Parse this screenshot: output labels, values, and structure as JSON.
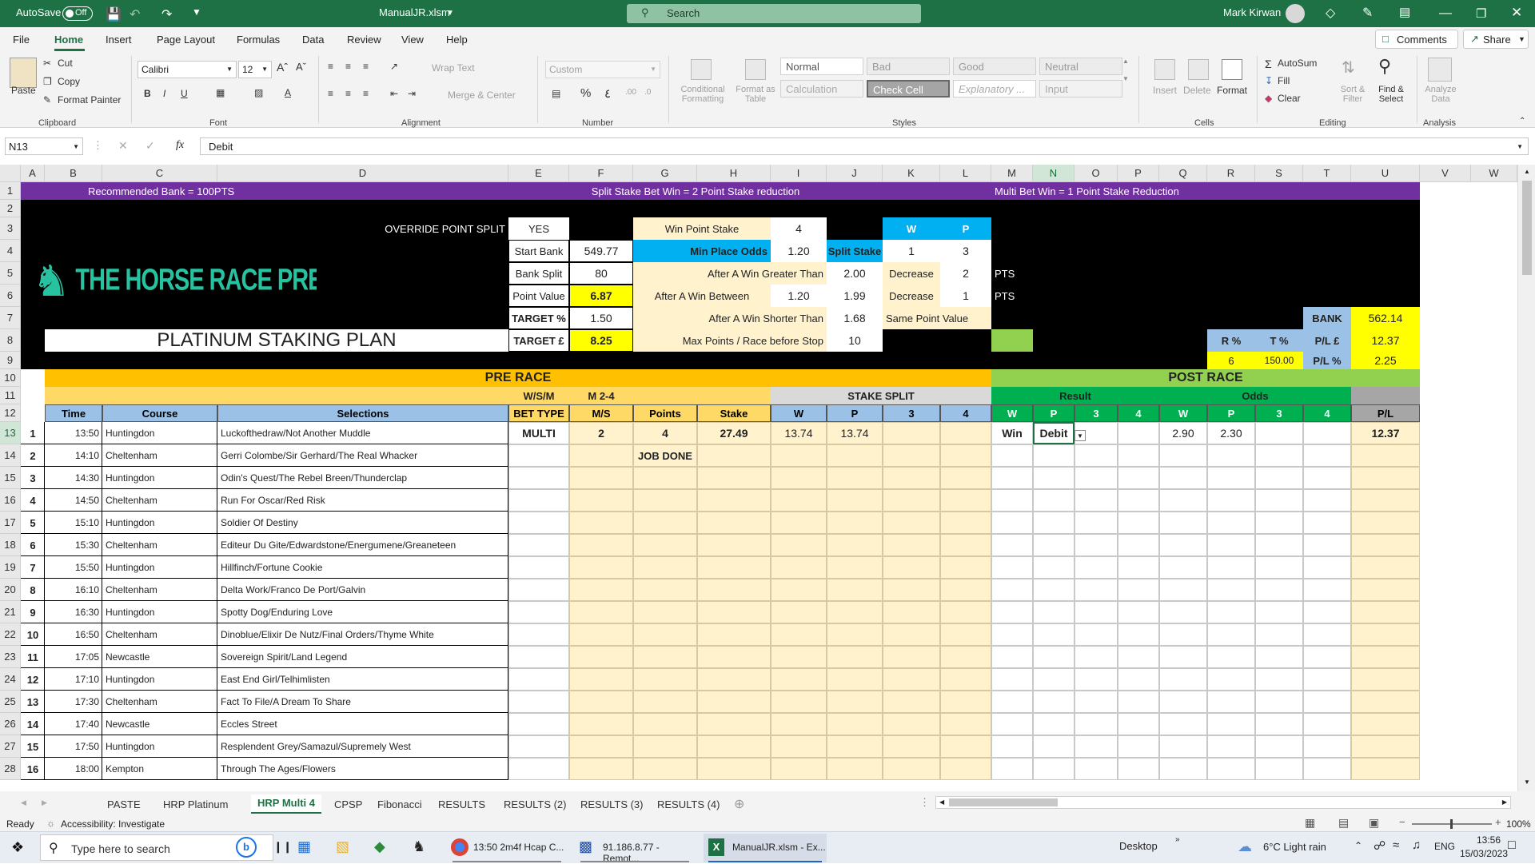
{
  "title_bar": {
    "autosave_label": "AutoSave",
    "autosave_state": "Off",
    "file_name": "ManualJR.xlsm",
    "search_placeholder": "Search",
    "user_name": "Mark Kirwan"
  },
  "menu": {
    "tabs": [
      "File",
      "Home",
      "Insert",
      "Page Layout",
      "Formulas",
      "Data",
      "Review",
      "View",
      "Help"
    ],
    "active_tab": "Home",
    "comments": "Comments",
    "share": "Share"
  },
  "ribbon": {
    "clipboard": {
      "paste": "Paste",
      "cut": "Cut",
      "copy": "Copy",
      "format_painter": "Format Painter",
      "group": "Clipboard"
    },
    "font": {
      "name": "Calibri",
      "size": "12",
      "group": "Font"
    },
    "alignment": {
      "wrap_text": "Wrap Text",
      "merge_center": "Merge & Center",
      "group": "Alignment"
    },
    "number": {
      "format": "Custom",
      "group": "Number"
    },
    "styles": {
      "conditional_formatting": "Conditional Formatting",
      "format_as_table": "Format as Table",
      "normal": "Normal",
      "bad": "Bad",
      "good": "Good",
      "neutral": "Neutral",
      "calculation": "Calculation",
      "check_cell": "Check Cell",
      "explanatory": "Explanatory ...",
      "input": "Input",
      "group": "Styles"
    },
    "cells": {
      "insert": "Insert",
      "delete": "Delete",
      "format": "Format",
      "group": "Cells"
    },
    "editing": {
      "autosum": "AutoSum",
      "fill": "Fill",
      "clear": "Clear",
      "sort_filter": "Sort & Filter",
      "find_select": "Find & Select",
      "group": "Editing"
    },
    "analysis": {
      "analyze_data": "Analyze Data",
      "group": "Analysis"
    }
  },
  "formula_bar": {
    "name_box": "N13",
    "fx": "fx",
    "value": "Debit"
  },
  "columns": [
    "A",
    "B",
    "C",
    "D",
    "E",
    "F",
    "G",
    "H",
    "I",
    "J",
    "K",
    "L",
    "M",
    "N",
    "O",
    "P",
    "Q",
    "R",
    "S",
    "T",
    "U",
    "V",
    "W"
  ],
  "row_numbers": [
    "1",
    "2",
    "3",
    "4",
    "5",
    "6",
    "7",
    "8",
    "9",
    "10",
    "11",
    "12",
    "13",
    "14",
    "15",
    "16",
    "17",
    "18",
    "19",
    "20",
    "21",
    "22",
    "23",
    "24",
    "25",
    "26",
    "27",
    "28"
  ],
  "sheet": {
    "banner_left": "Recommended Bank = 100PTS",
    "banner_mid": "Split Stake Bet Win = 2 Point Stake reduction",
    "banner_right": "Multi Bet Win = 1 Point  Stake Reduction",
    "logo_text": "THE HORSE RACE PREDICTOR",
    "plan_title": "PLATINUM STAKING PLAN",
    "override_label": "OVERRIDE POINT SPLIT",
    "override_value": "YES",
    "start_bank_label": "Start Bank",
    "start_bank": "549.77",
    "bank_split_label": "Bank Split",
    "bank_split": "80",
    "point_value_label": "Point Value",
    "point_value": "6.87",
    "target_pct_label": "TARGET %",
    "target_pct": "1.50",
    "target_gbp_label": "TARGET £",
    "target_gbp": "8.25",
    "win_point_stake_label": "Win Point Stake",
    "win_point_stake": "4",
    "min_place_odds_label": "Min Place Odds",
    "min_place_odds": "1.20",
    "split_stake_label": "Split Stake",
    "split_w": "1",
    "split_p": "3",
    "w_label": "W",
    "p_label": "P",
    "after_win_greater_label": "After A Win Greater Than",
    "after_win_greater": "2.00",
    "decrease_label": "Decrease",
    "decrease_1": "2",
    "pts1": "PTS",
    "after_win_between_label": "After A Win Between",
    "between_low": "1.20",
    "between_high": "1.99",
    "decrease_2": "1",
    "pts2": "PTS",
    "after_win_shorter_label": "After A Win Shorter Than",
    "shorter": "1.68",
    "same_point_value": "Same Point Value",
    "max_points_label": "Max Points / Race before Stop",
    "max_points": "10",
    "bank_label": "BANK",
    "bank": "562.14",
    "r_pct_label": "R %",
    "t_pct_label": "T %",
    "pl_gbp_label": "P/L £",
    "pl_gbp": "12.37",
    "r_pct": "6",
    "t_pct": "150.00",
    "pl_pct_label": "P/L %",
    "pl_pct": "2.25",
    "pre_race": "PRE RACE",
    "post_race": "POST RACE",
    "wsm": "W/S/M",
    "m24": "M 2-4",
    "stake_split": "STAKE SPLIT",
    "result": "Result",
    "odds": "Odds",
    "headers": [
      "Time",
      "Course",
      "Selections",
      "BET TYPE",
      "M/S",
      "Points",
      "Stake",
      "W",
      "P",
      "3",
      "4",
      "W",
      "P",
      "3",
      "4",
      "W",
      "P",
      "3",
      "4",
      "P/L"
    ],
    "row13": {
      "bet_type": "MULTI",
      "ms": "2",
      "points": "4",
      "stake": "27.49",
      "w": "13.74",
      "p": "13.74",
      "res_w": "Win",
      "res_p": "Debit",
      "odd_w": "2.90",
      "odd_p": "2.30",
      "pl": "12.37"
    },
    "job_done": "JOB DONE",
    "races": [
      {
        "n": "1",
        "time": "13:50",
        "course": "Huntingdon",
        "sel": "Luckofthedraw/Not Another Muddle"
      },
      {
        "n": "2",
        "time": "14:10",
        "course": "Cheltenham",
        "sel": "Gerri Colombe/Sir Gerhard/The Real Whacker"
      },
      {
        "n": "3",
        "time": "14:30",
        "course": "Huntingdon",
        "sel": "Odin's Quest/The Rebel Breen/Thunderclap"
      },
      {
        "n": "4",
        "time": "14:50",
        "course": "Cheltenham",
        "sel": "Run For Oscar/Red Risk"
      },
      {
        "n": "5",
        "time": "15:10",
        "course": "Huntingdon",
        "sel": "Soldier Of Destiny"
      },
      {
        "n": "6",
        "time": "15:30",
        "course": "Cheltenham",
        "sel": "Editeur Du Gite/Edwardstone/Energumene/Greaneteen"
      },
      {
        "n": "7",
        "time": "15:50",
        "course": "Huntingdon",
        "sel": "Hillfinch/Fortune Cookie"
      },
      {
        "n": "8",
        "time": "16:10",
        "course": "Cheltenham",
        "sel": "Delta Work/Franco De Port/Galvin"
      },
      {
        "n": "9",
        "time": "16:30",
        "course": "Huntingdon",
        "sel": "Spotty Dog/Enduring Love"
      },
      {
        "n": "10",
        "time": "16:50",
        "course": "Cheltenham",
        "sel": "Dinoblue/Elixir De Nutz/Final Orders/Thyme White"
      },
      {
        "n": "11",
        "time": "17:05",
        "course": "Newcastle",
        "sel": "Sovereign Spirit/Land Legend"
      },
      {
        "n": "12",
        "time": "17:10",
        "course": "Huntingdon",
        "sel": "East End Girl/Telhimlisten"
      },
      {
        "n": "13",
        "time": "17:30",
        "course": "Cheltenham",
        "sel": "Fact To File/A Dream To Share"
      },
      {
        "n": "14",
        "time": "17:40",
        "course": "Newcastle",
        "sel": "Eccles Street"
      },
      {
        "n": "15",
        "time": "17:50",
        "course": "Huntingdon",
        "sel": "Resplendent Grey/Samazul/Supremely West"
      },
      {
        "n": "16",
        "time": "18:00",
        "course": "Kempton",
        "sel": "Through The Ages/Flowers"
      }
    ]
  },
  "sheet_tabs": [
    "PASTE",
    "HRP Platinum",
    "HRP Multi 4",
    "CPSP",
    "Fibonacci",
    "RESULTS",
    "RESULTS (2)",
    "RESULTS (3)",
    "RESULTS (4)"
  ],
  "active_sheet": "HRP Multi 4",
  "status": {
    "ready": "Ready",
    "accessibility": "Accessibility: Investigate",
    "zoom": "100%"
  },
  "taskbar": {
    "search": "Type here to search",
    "app1": "13:50 2m4f Hcap C...",
    "app2": "91.186.8.77 - Remot...",
    "app3": "ManualJR.xlsm - Ex...",
    "desktop": "Desktop",
    "weather": "6°C  Light rain",
    "lang": "ENG",
    "time": "13:56",
    "date": "15/03/2023"
  },
  "colors": {
    "excel_green": "#1e7145",
    "purple": "#7030a0",
    "orange": "#ffc000",
    "light_orange": "#ffd966",
    "cream": "#fff2cc",
    "yellow": "#ffff00",
    "cyan": "#00b0f0",
    "blue_header": "#9bc2e6",
    "green": "#00b050",
    "light_green": "#92d050",
    "grey": "#a6a6a6"
  }
}
